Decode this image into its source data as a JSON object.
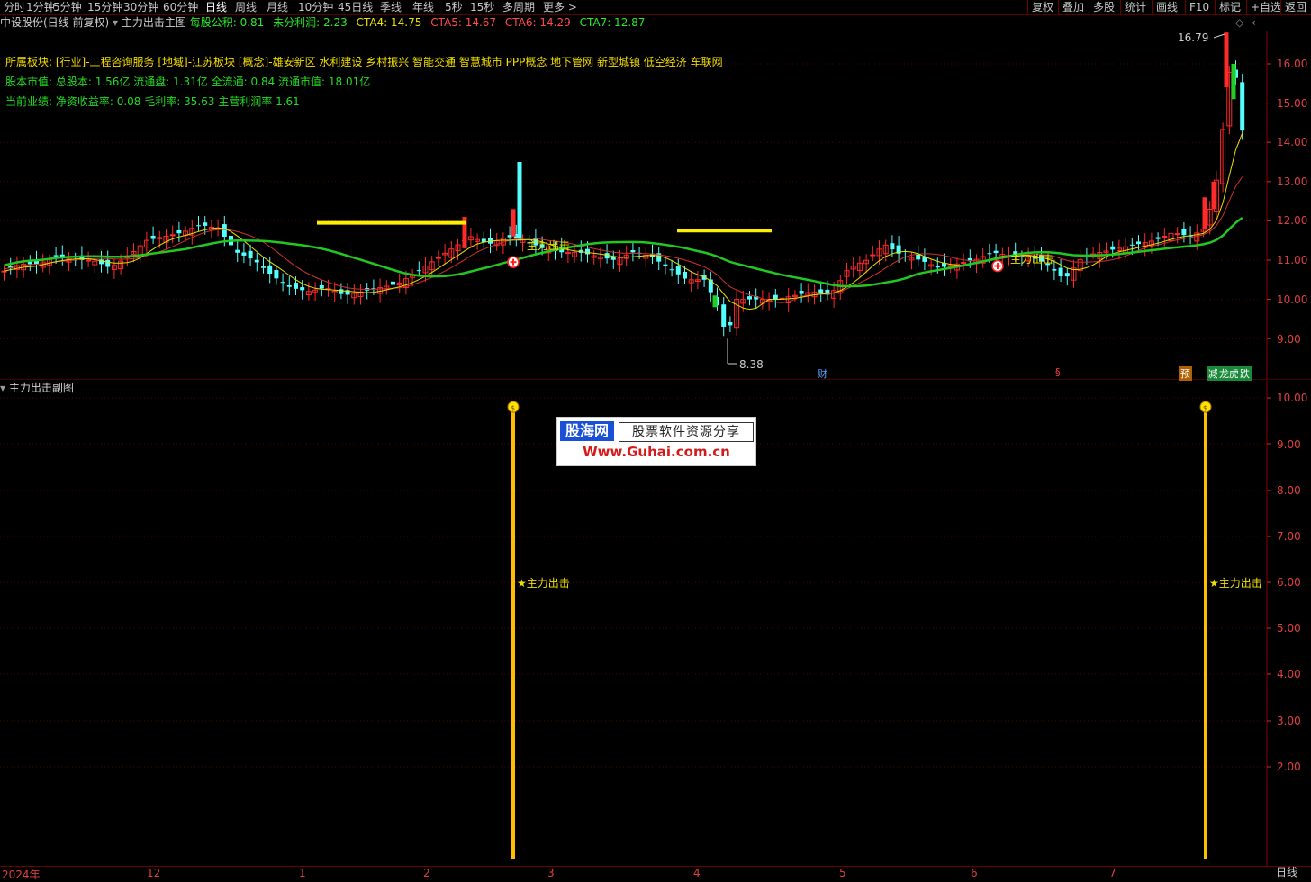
{
  "toolbar": {
    "periods": [
      "分时",
      "1分钟",
      "5分钟",
      "15分钟",
      "30分钟",
      "60分钟",
      "日线",
      "周线",
      "月线",
      "10分钟",
      "45日线",
      "季线",
      "年线",
      "5秒",
      "15秒",
      "多周期",
      "更多 >"
    ],
    "active_period": "日线",
    "right_buttons": [
      "复权",
      "叠加",
      "多股",
      "统计",
      "画线",
      "F10",
      "标记",
      "+自选",
      "返回"
    ]
  },
  "header": {
    "stock": "中设股份(日线 前复权)",
    "indicator": "主力出击主图",
    "eps_label": "每股公积:",
    "eps_value": "0.81",
    "undist_label": "未分利润:",
    "undist_value": "2.23",
    "cta4": "CTA4: 14.75",
    "cta5": "CTA5: 14.67",
    "cta6": "CTA6: 14.29",
    "cta7": "CTA7: 12.87"
  },
  "info": {
    "sector": "所属板块: [行业]-工程咨询服务 [地域]-江苏板块 [概念]-雄安新区 水利建设 乡村振兴 智能交通 智慧城市 PPP概念 地下管网 新型城镇 低空经济 车联网",
    "capital": "股本市值: 总股本: 1.56亿 流通盘: 1.31亿 全流通: 0.84 流通市值: 18.01亿",
    "performance": "当前业绩: 净资收益率: 0.08 毛利率: 35.63 主营利润率 1.61"
  },
  "main_chart": {
    "y_ticks": [
      "16.00",
      "15.00",
      "14.00",
      "13.00",
      "12.00",
      "11.00",
      "10.00",
      "9.00"
    ],
    "high_label": "16.79",
    "low_label": "8.38",
    "signal_label": "主力出击",
    "markers": [
      "财",
      "§",
      "预",
      "减",
      "龙虎榜",
      "跌"
    ]
  },
  "sub_chart": {
    "title": "主力出击副图",
    "y_ticks": [
      "10.00",
      "9.00",
      "8.00",
      "7.00",
      "6.00",
      "5.00",
      "4.00",
      "3.00",
      "2.00"
    ],
    "signal_label": "★主力出击"
  },
  "x_axis": {
    "labels": [
      "2024年",
      "12",
      "1",
      "2",
      "3",
      "4",
      "5",
      "6",
      "7"
    ],
    "period_button": "日线"
  },
  "watermark": {
    "logo": "股海网",
    "slogan": "股票软件资源分享",
    "url": "Www.Guhai.com.cn"
  },
  "colors": {
    "up": "#ff2a2a",
    "down": "#54ffff",
    "ma_green": "#22c722",
    "ma_yellow": "#e8e000",
    "ma_red": "#d03030",
    "axis": "#e04040",
    "signal_bar": "#ffb400"
  }
}
